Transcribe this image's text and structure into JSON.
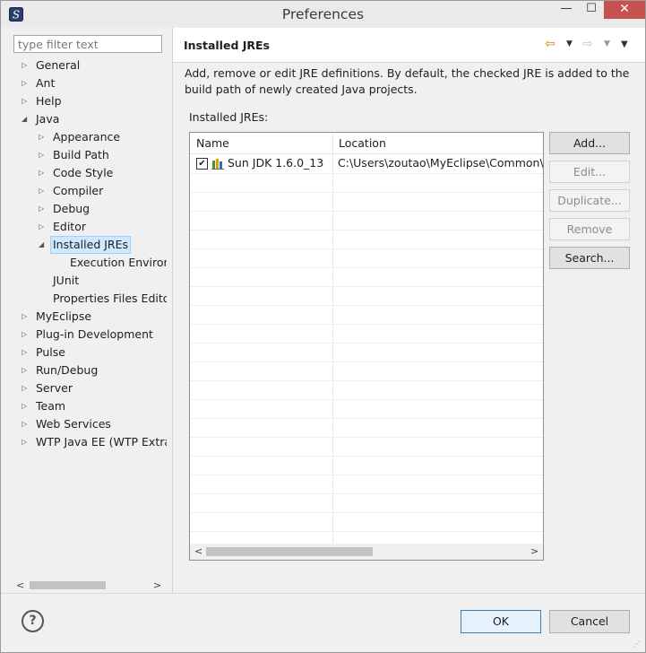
{
  "window": {
    "title": "Preferences",
    "minimize_glyph": "—",
    "maximize_glyph": "☐",
    "close_glyph": "✕"
  },
  "filter": {
    "placeholder": "type filter text",
    "value": ""
  },
  "tree": [
    {
      "label": "General",
      "depth": 0,
      "twisty": "collapsed"
    },
    {
      "label": "Ant",
      "depth": 0,
      "twisty": "collapsed"
    },
    {
      "label": "Help",
      "depth": 0,
      "twisty": "collapsed"
    },
    {
      "label": "Java",
      "depth": 0,
      "twisty": "expanded"
    },
    {
      "label": "Appearance",
      "depth": 1,
      "twisty": "collapsed"
    },
    {
      "label": "Build Path",
      "depth": 1,
      "twisty": "collapsed"
    },
    {
      "label": "Code Style",
      "depth": 1,
      "twisty": "collapsed"
    },
    {
      "label": "Compiler",
      "depth": 1,
      "twisty": "collapsed"
    },
    {
      "label": "Debug",
      "depth": 1,
      "twisty": "collapsed"
    },
    {
      "label": "Editor",
      "depth": 1,
      "twisty": "collapsed"
    },
    {
      "label": "Installed JREs",
      "depth": 1,
      "twisty": "expanded",
      "selected": true
    },
    {
      "label": "Execution Environi",
      "depth": 2,
      "twisty": "none"
    },
    {
      "label": "JUnit",
      "depth": 1,
      "twisty": "none"
    },
    {
      "label": "Properties Files Edito",
      "depth": 1,
      "twisty": "none"
    },
    {
      "label": "MyEclipse",
      "depth": 0,
      "twisty": "collapsed"
    },
    {
      "label": "Plug-in Development",
      "depth": 0,
      "twisty": "collapsed"
    },
    {
      "label": "Pulse",
      "depth": 0,
      "twisty": "collapsed"
    },
    {
      "label": "Run/Debug",
      "depth": 0,
      "twisty": "collapsed"
    },
    {
      "label": "Server",
      "depth": 0,
      "twisty": "collapsed"
    },
    {
      "label": "Team",
      "depth": 0,
      "twisty": "collapsed"
    },
    {
      "label": "Web Services",
      "depth": 0,
      "twisty": "collapsed"
    },
    {
      "label": "WTP Java EE (WTP Extras",
      "depth": 0,
      "twisty": "collapsed"
    }
  ],
  "page": {
    "title": "Installed JREs",
    "description": "Add, remove or edit JRE definitions. By default, the checked JRE is added to the build path of newly created Java projects.",
    "list_label": "Installed JREs:"
  },
  "table": {
    "columns": [
      "Name",
      "Location"
    ],
    "rows": [
      {
        "checked": true,
        "name": "Sun JDK 1.6.0_13",
        "location": "C:\\Users\\zoutao\\MyEclipse\\Common\\b"
      }
    ]
  },
  "buttons": {
    "add": "Add...",
    "edit": "Edit...",
    "duplicate": "Duplicate...",
    "remove": "Remove",
    "search": "Search...",
    "ok": "OK",
    "cancel": "Cancel"
  },
  "icons": {
    "twisty_collapsed": "▷",
    "twisty_expanded": "◢",
    "scroll_left": "<",
    "scroll_right": ">",
    "check": "✔",
    "help": "?"
  }
}
